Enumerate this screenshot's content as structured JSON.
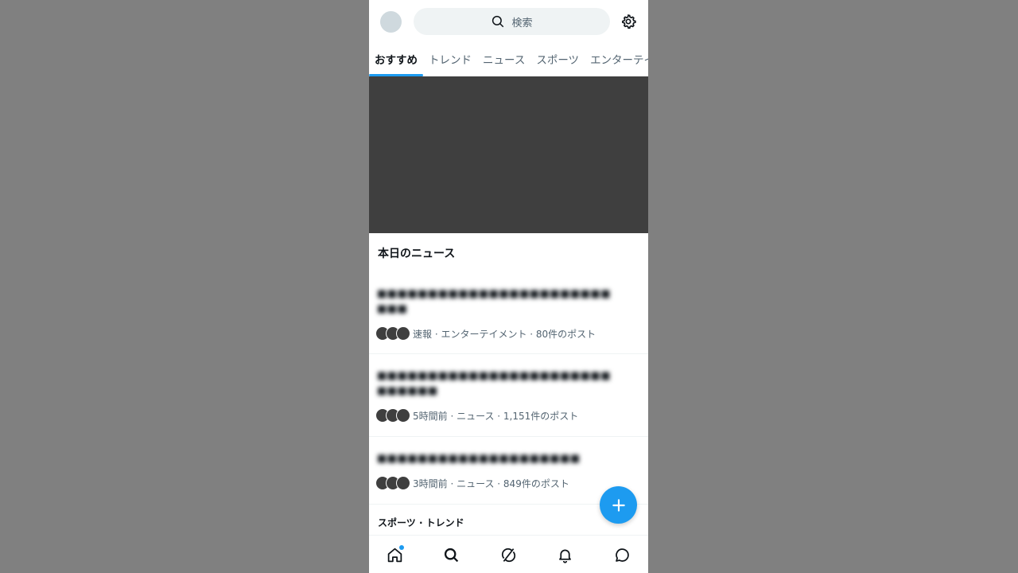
{
  "header": {
    "search_placeholder": "検索"
  },
  "tabs": [
    {
      "label": "おすすめ",
      "active": true
    },
    {
      "label": "トレンド",
      "active": false
    },
    {
      "label": "ニュース",
      "active": false
    },
    {
      "label": "スポーツ",
      "active": false
    },
    {
      "label": "エンターテイ",
      "active": false
    }
  ],
  "section": {
    "title": "本日のニュース"
  },
  "news": [
    {
      "headline": "■■■■■■■■■■■■■■■■■■■■■■■ ■■■",
      "meta": "速報 · エンターテイメント · 80件のポスト"
    },
    {
      "headline": "■■■■■■■■■■■■■■■■■■■■■■■ ■■■■■■",
      "meta": "5時間前 · ニュース · 1,151件のポスト"
    },
    {
      "headline": "■■■■■■■■■■■■■■■■■■■■",
      "meta": "3時間前 · ニュース · 849件のポスト"
    }
  ],
  "sports_section": {
    "title": "スポーツ · トレンド"
  },
  "colors": {
    "accent": "#1d9bf0",
    "hero": "#3f3f3f",
    "backdrop": "#808080"
  },
  "nav": {
    "items": [
      "home-icon",
      "search-icon",
      "grok-icon",
      "bell-icon",
      "message-icon"
    ],
    "home_notification": true
  }
}
